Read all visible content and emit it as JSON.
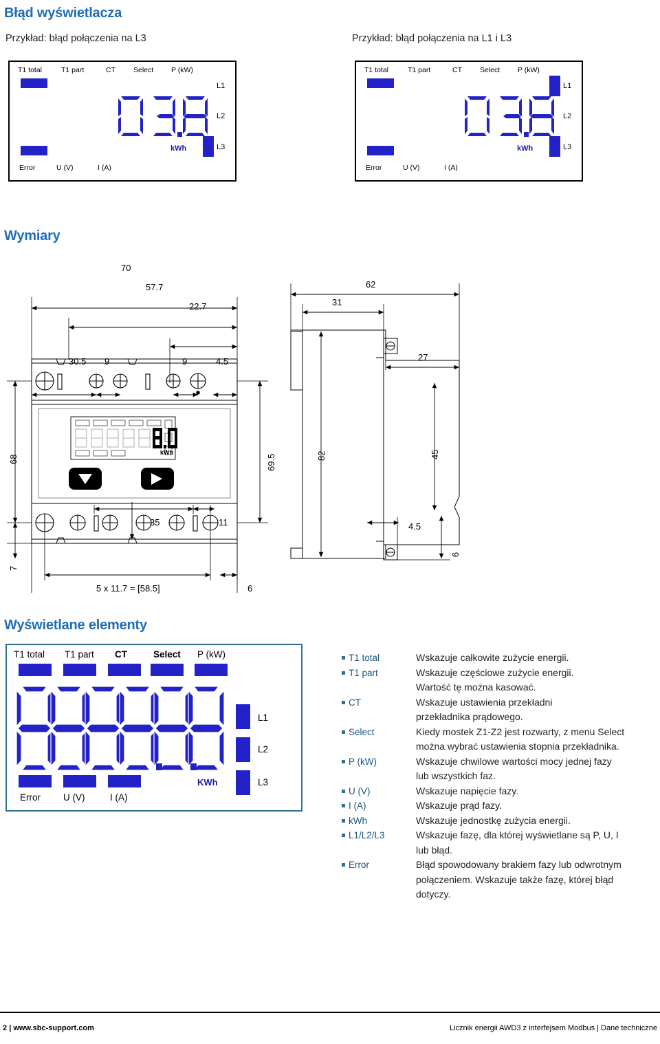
{
  "sections": {
    "display_error": "Błąd wyświetlacza",
    "dimensions": "Wymiary",
    "displayed_elements": "Wyświetlane elementy"
  },
  "examples": [
    {
      "caption": "Przykład: błąd połączenia na L3"
    },
    {
      "caption": "Przykład: błąd połączenia na L1 i L3"
    }
  ],
  "lcd": {
    "top_labels": [
      "T1 total",
      "T1 part",
      "CT",
      "Select",
      "P (kW)"
    ],
    "bottom_labels": [
      "Error",
      "U (V)",
      "I (A)"
    ],
    "phases": [
      "L1",
      "L2",
      "L3"
    ],
    "unit": "kWh",
    "unit_big": "KWh",
    "value": "03.8"
  },
  "dimension_labels": {
    "front": {
      "width_total": "70",
      "width_57": "57.7",
      "width_22": "22.7",
      "d30_5": "30.5",
      "d9_a": "9",
      "d9_b": "9",
      "d4_5": "4.5",
      "height_68": "68",
      "height_69_5": "69.5",
      "d35": "35",
      "d11": "11",
      "d7": "7",
      "pitch": "5 x 11.7 = [58.5]",
      "d6": "6",
      "unit_kwh": "kWh"
    },
    "side": {
      "depth_62": "62",
      "depth_31": "31",
      "depth_27": "27",
      "height_82": "82",
      "height_45": "45",
      "d4_5": "4.5",
      "d6": "6"
    }
  },
  "legend": [
    {
      "term": "T1 total",
      "lines": [
        "Wskazuje całkowite zużycie energii."
      ]
    },
    {
      "term": "T1 part",
      "lines": [
        "Wskazuje częściowe zużycie energii.",
        "Wartość tę można kasować."
      ]
    },
    {
      "term": "CT",
      "lines": [
        "Wskazuje ustawienia przekładni",
        "przekładnika prądowego."
      ]
    },
    {
      "term": "Select",
      "lines": [
        "Kiedy mostek Z1-Z2 jest rozwarty, z menu Select",
        "można wybrać ustawienia stopnia przekładnika."
      ]
    },
    {
      "term": "P (kW)",
      "lines": [
        "Wskazuje chwilowe wartości mocy jednej fazy",
        "lub wszystkich faz."
      ]
    },
    {
      "term": "U (V)",
      "lines": [
        "Wskazuje napięcie fazy."
      ]
    },
    {
      "term": "I (A)",
      "lines": [
        "Wskazuje prąd fazy."
      ]
    },
    {
      "term": "kWh",
      "lines": [
        "Wskazuje jednostkę zużycia energii."
      ]
    },
    {
      "term": "L1/L2/L3",
      "lines": [
        "Wskazuje fazę, dla której wyświetlane są P, U, I",
        "lub błąd."
      ]
    },
    {
      "term": "Error",
      "lines": [
        "Błąd spowodowany brakiem fazy lub odwrotnym",
        "połączeniem. Wskazuje także fazę, której błąd",
        "dotyczy."
      ]
    }
  ],
  "footer": {
    "page": "2",
    "separator": "|",
    "site": "www.sbc-support.com",
    "right": "Licznik energii AWD3 z interfejsem Modbus | Dane techniczne"
  },
  "colors": {
    "heading_blue": "#1f6eb5",
    "segment_blue": "#2222c8",
    "legend_term": "#18567e",
    "lcd_border_big": "#2f6f8f"
  }
}
